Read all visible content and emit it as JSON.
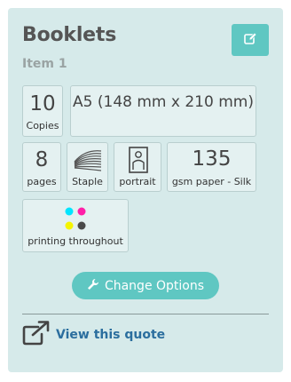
{
  "card": {
    "title": "Booklets",
    "subtitle": "Item 1"
  },
  "specs": {
    "copies": {
      "value": "10",
      "label": "Copies"
    },
    "size": {
      "value": "A5 (148 mm x 210 mm)"
    },
    "pages": {
      "value": "8",
      "label": "pages"
    },
    "binding": {
      "label": "Staple",
      "icon": "staple-booklet-icon"
    },
    "orientation": {
      "label": "portrait",
      "icon": "portrait-icon"
    },
    "paper": {
      "value": "135",
      "label": "gsm paper - Silk"
    },
    "printing": {
      "label": "printing throughout",
      "icon": "cmyk-dots-icon"
    }
  },
  "actions": {
    "change_options": "Change Options",
    "view_quote": "View this quote"
  },
  "colors": {
    "card_bg": "#d6eaea",
    "accent": "#5fc7c2",
    "link": "#2b6e9e",
    "cyan": "#00e5ff",
    "magenta": "#ff1fa8",
    "yellow": "#f5f500",
    "black": "#4a4a4a"
  }
}
